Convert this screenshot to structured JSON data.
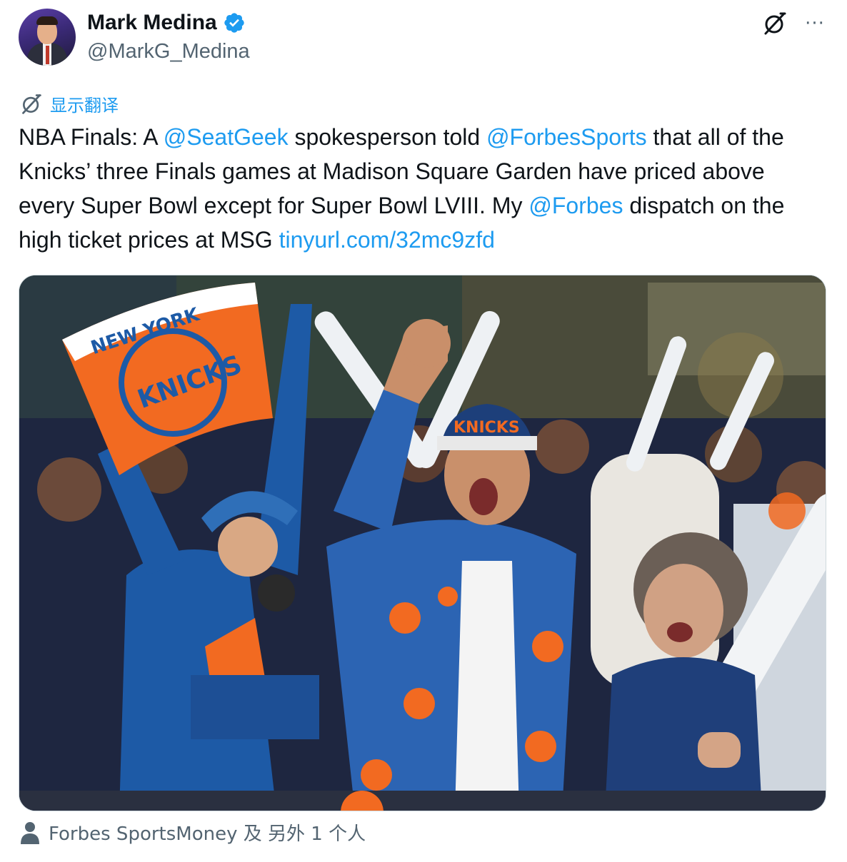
{
  "author": {
    "display_name": "Mark Medina",
    "handle": "@MarkG_Medina",
    "verified": true
  },
  "actions": {
    "grok_icon": "grok-icon",
    "more_icon": "more-options-icon",
    "more_glyph": "···"
  },
  "translate": {
    "label": "显示翻译",
    "icon": "translate-icon"
  },
  "tweet": {
    "segments": [
      {
        "text": "NBA Finals: A ",
        "link": false
      },
      {
        "text": "@SeatGeek",
        "link": true
      },
      {
        "text": " spokesperson told ",
        "link": false
      },
      {
        "text": "@ForbesSports",
        "link": true
      },
      {
        "text": " that all of the Knicks’ three Finals games at Madison Square Garden have priced above every Super Bowl except for Super Bowl LVIII. My ",
        "link": false
      },
      {
        "text": "@Forbes",
        "link": true
      },
      {
        "text": " dispatch on the high ticket prices at MSG ",
        "link": false
      },
      {
        "text": "tinyurl.com/32mc9zfd",
        "link": true
      }
    ]
  },
  "media": {
    "description_icon": "photo-image",
    "towel_text": "NEW YORK",
    "towel_logo": "KNICKS",
    "hat_text": "KNICKS"
  },
  "tagged": {
    "label": "Forbes SportsMoney 及 另外 1 个人",
    "icon": "person-icon"
  },
  "colors": {
    "link": "#1d9bf0",
    "secondary_text": "#536471",
    "verified_badge": "#1d9bf0",
    "knicks_orange": "#f26a21",
    "knicks_blue": "#1d5aa6"
  }
}
